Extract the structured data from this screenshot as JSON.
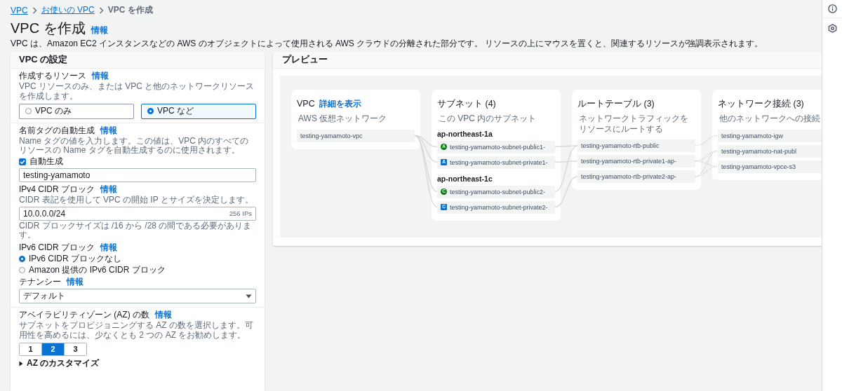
{
  "breadcrumbs": [
    {
      "label": "VPC",
      "link": true
    },
    {
      "label": "お使いの VPC",
      "link": true
    },
    {
      "label": "VPC を作成",
      "link": false
    }
  ],
  "page": {
    "title": "VPC を作成",
    "info": "情報",
    "description": "VPC は、Amazon EC2 インスタンスなどの AWS のオブジェクトによって使用される AWS クラウドの分離された部分です。 リソースの上にマウスを置くと、関連するリソースが強調表示されます。"
  },
  "settings": {
    "title": "VPC の設定",
    "resources": {
      "label": "作成するリソース",
      "info": "情報",
      "description": "VPC リソースのみ、または VPC と他のネットワークリソースを作成します。",
      "options": [
        {
          "label": "VPC のみ",
          "selected": false
        },
        {
          "label": "VPC など",
          "selected": true
        }
      ]
    },
    "name_tag": {
      "label": "名前タグの自動生成",
      "info": "情報",
      "description": "Name タグの値を入力します。この値は、VPC 内のすべてのリソースの Name タグを自動生成するのに使用されます。",
      "checkbox": {
        "label": "自動生成",
        "checked": true
      },
      "value": "testing-yamamoto"
    },
    "ipv4": {
      "label": "IPv4 CIDR ブロック",
      "info": "情報",
      "description": "CIDR 表記を使用して VPC の開始 IP とサイズを決定します。",
      "value": "10.0.0.0/24",
      "suffix": "256 IPs",
      "hint": "CIDR ブロックサイズは /16 から /28 の間である必要があります。"
    },
    "ipv6": {
      "label": "IPv6 CIDR ブロック",
      "info": "情報",
      "options": [
        {
          "label": "IPv6 CIDR ブロックなし",
          "selected": true
        },
        {
          "label": "Amazon 提供の IPv6 CIDR ブロック",
          "selected": false
        }
      ]
    },
    "tenancy": {
      "label": "テナンシー",
      "info": "情報",
      "value": "デフォルト"
    },
    "az": {
      "label": "アベイラビリティゾーン (AZ) の数",
      "info": "情報",
      "description": "サブネットをプロビジョニングする AZ の数を選択します。可用性を高めるには、少なくとも 2 つの AZ をお勧めします。",
      "options": [
        {
          "label": "1",
          "selected": false
        },
        {
          "label": "2",
          "selected": true
        },
        {
          "label": "3",
          "selected": false
        }
      ],
      "customize": {
        "label": "AZ のカスタマイズ",
        "expanded": false
      }
    }
  },
  "preview": {
    "title": "プレビュー",
    "columns": [
      {
        "title": "VPC",
        "link": "詳細を表示",
        "subtitle": "AWS 仮想ネットワーク",
        "groups": [
          {
            "items": [
              {
                "name": "testing-yamamoto-vpc"
              }
            ]
          }
        ]
      },
      {
        "title": "サブネット (4)",
        "subtitle": "この VPC 内のサブネット",
        "groups": [
          {
            "heading": "ap-northeast-1a",
            "items": [
              {
                "name": "testing-yamamoto-subnet-public1-",
                "badge": "A",
                "kind": "public"
              },
              {
                "name": "testing-yamamoto-subnet-private1-",
                "badge": "A",
                "kind": "private"
              }
            ]
          },
          {
            "heading": "ap-northeast-1c",
            "items": [
              {
                "name": "testing-yamamoto-subnet-public2-",
                "badge": "C",
                "kind": "public"
              },
              {
                "name": "testing-yamamoto-subnet-private2-",
                "badge": "C",
                "kind": "private"
              }
            ]
          }
        ]
      },
      {
        "title": "ルートテーブル (3)",
        "subtitle": "ネットワークトラフィックをリソースにルートする",
        "groups": [
          {
            "items": [
              {
                "name": "testing-yamamoto-rtb-public"
              },
              {
                "name": "testing-yamamoto-rtb-private1-ap-"
              },
              {
                "name": "testing-yamamoto-rtb-private2-ap-"
              }
            ]
          }
        ]
      },
      {
        "title": "ネットワーク接続 (3)",
        "subtitle": "他のネットワークへの接続",
        "groups": [
          {
            "items": [
              {
                "name": "testing-yamamoto-igw"
              },
              {
                "name": "testing-yamamoto-nat-publ"
              },
              {
                "name": "testing-yamamoto-vpce-s3"
              }
            ]
          }
        ]
      }
    ]
  }
}
